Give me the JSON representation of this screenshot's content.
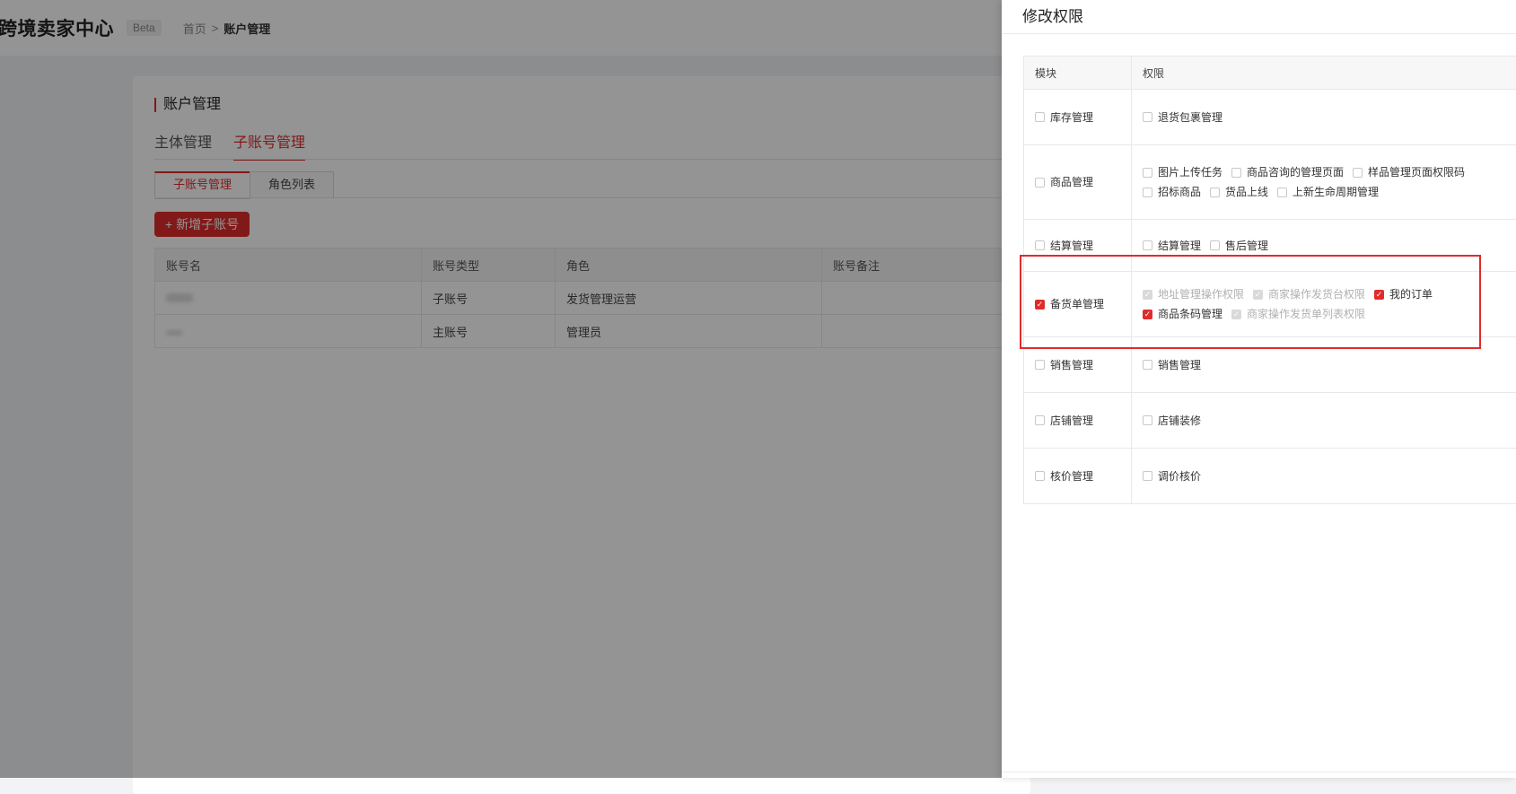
{
  "header": {
    "logo": "跨境卖家中心",
    "beta": "Beta",
    "breadcrumb": {
      "home": "首页",
      "separator": ">",
      "current": "账户管理"
    }
  },
  "page": {
    "title": "账户管理",
    "main_tabs": [
      {
        "label": "主体管理",
        "active": false
      },
      {
        "label": "子账号管理",
        "active": true
      }
    ],
    "sub_tabs": [
      {
        "label": "子账号管理",
        "active": true
      },
      {
        "label": "角色列表",
        "active": false
      }
    ],
    "add_button": "+ 新增子账号",
    "table": {
      "columns": [
        "账号名",
        "账号类型",
        "角色",
        "账号备注"
      ],
      "rows": [
        {
          "name": "",
          "type": "子账号",
          "role": "发货管理运营",
          "note": ""
        },
        {
          "name": "",
          "type": "主账号",
          "role": "管理员",
          "note": ""
        }
      ]
    }
  },
  "drawer": {
    "title": "修改权限",
    "columns": {
      "module": "模块",
      "permission": "权限"
    },
    "rows": [
      {
        "module": {
          "label": "库存管理",
          "state": "unchecked"
        },
        "lines": [
          [
            {
              "label": "退货包裹管理",
              "state": "unchecked"
            }
          ]
        ]
      },
      {
        "module": {
          "label": "商品管理",
          "state": "unchecked"
        },
        "lines": [
          [
            {
              "label": "图片上传任务",
              "state": "unchecked"
            },
            {
              "label": "商品咨询的管理页面",
              "state": "unchecked"
            },
            {
              "label": "样品管理页面权限码",
              "state": "unchecked"
            }
          ],
          [
            {
              "label": "招标商品",
              "state": "unchecked"
            },
            {
              "label": "货品上线",
              "state": "unchecked"
            },
            {
              "label": "上新生命周期管理",
              "state": "unchecked"
            }
          ]
        ]
      },
      {
        "module": {
          "label": "结算管理",
          "state": "unchecked"
        },
        "lines": [
          [
            {
              "label": "结算管理",
              "state": "unchecked"
            },
            {
              "label": "售后管理",
              "state": "unchecked"
            }
          ]
        ]
      },
      {
        "module": {
          "label": "备货单管理",
          "state": "checked"
        },
        "lines": [
          [
            {
              "label": "地址管理操作权限",
              "state": "disabled-checked"
            },
            {
              "label": "商家操作发货台权限",
              "state": "disabled-checked"
            },
            {
              "label": "我的订单",
              "state": "checked"
            }
          ],
          [
            {
              "label": "商品条码管理",
              "state": "checked"
            },
            {
              "label": "商家操作发货单列表权限",
              "state": "disabled-checked"
            }
          ]
        ]
      },
      {
        "module": {
          "label": "销售管理",
          "state": "unchecked"
        },
        "lines": [
          [
            {
              "label": "销售管理",
              "state": "unchecked"
            }
          ]
        ]
      },
      {
        "module": {
          "label": "店铺管理",
          "state": "unchecked"
        },
        "lines": [
          [
            {
              "label": "店铺装修",
              "state": "unchecked"
            }
          ]
        ]
      },
      {
        "module": {
          "label": "核价管理",
          "state": "unchecked"
        },
        "lines": [
          [
            {
              "label": "调价核价",
              "state": "unchecked"
            }
          ]
        ]
      }
    ]
  },
  "colors": {
    "accent": "#e02b2b",
    "overlay": "rgba(0,0,0,0.42)",
    "disabled": "#d9d9d9"
  },
  "icons": {
    "check": "check-icon",
    "breadcrumb_separator": "chevron-right-icon"
  }
}
